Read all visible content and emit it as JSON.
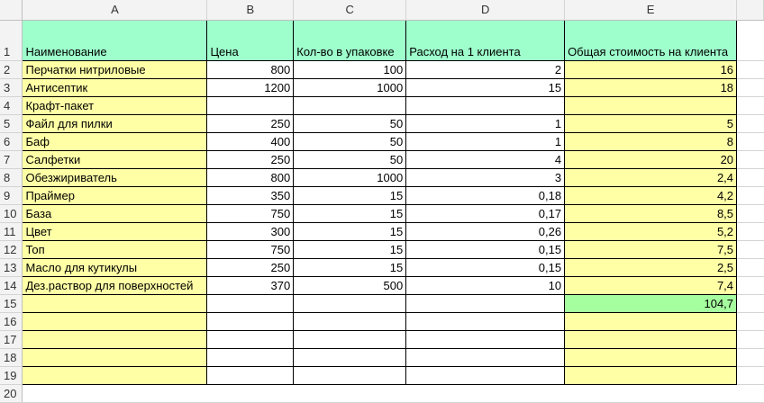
{
  "columns": [
    "A",
    "B",
    "C",
    "D",
    "E"
  ],
  "row_numbers": [
    "1",
    "2",
    "3",
    "4",
    "5",
    "6",
    "7",
    "8",
    "9",
    "10",
    "11",
    "12",
    "13",
    "14",
    "15",
    "16",
    "17",
    "18",
    "19",
    "20"
  ],
  "header": {
    "name": "Наименование",
    "price": "Цена",
    "pack_qty": "Кол-во в упаковке",
    "usage": "Расход на 1 клиента",
    "total": "Общая стоимость на клиента"
  },
  "rows": [
    {
      "name": "Перчатки нитриловые",
      "price": "800",
      "pack_qty": "100",
      "usage": "2",
      "total": "16"
    },
    {
      "name": "Антисептик",
      "price": "1200",
      "pack_qty": "1000",
      "usage": "15",
      "total": "18"
    },
    {
      "name": "Крафт-пакет",
      "price": "",
      "pack_qty": "",
      "usage": "",
      "total": ""
    },
    {
      "name": "Файл для пилки",
      "price": "250",
      "pack_qty": "50",
      "usage": "1",
      "total": "5"
    },
    {
      "name": "Баф",
      "price": "400",
      "pack_qty": "50",
      "usage": "1",
      "total": "8"
    },
    {
      "name": "Салфетки",
      "price": "250",
      "pack_qty": "50",
      "usage": "4",
      "total": "20"
    },
    {
      "name": "Обезжириватель",
      "price": "800",
      "pack_qty": "1000",
      "usage": "3",
      "total": "2,4"
    },
    {
      "name": "Праймер",
      "price": "350",
      "pack_qty": "15",
      "usage": "0,18",
      "total": "4,2"
    },
    {
      "name": "База",
      "price": "750",
      "pack_qty": "15",
      "usage": "0,17",
      "total": "8,5"
    },
    {
      "name": "Цвет",
      "price": "300",
      "pack_qty": "15",
      "usage": "0,26",
      "total": "5,2"
    },
    {
      "name": "Топ",
      "price": "750",
      "pack_qty": "15",
      "usage": "0,15",
      "total": "7,5"
    },
    {
      "name": "Масло для кутикулы",
      "price": "250",
      "pack_qty": "15",
      "usage": "0,15",
      "total": "2,5"
    },
    {
      "name": "Дез.раствор для поверхностей",
      "price": "370",
      "pack_qty": "500",
      "usage": "10",
      "total": "7,4"
    }
  ],
  "grand_total": "104,7",
  "colors": {
    "header_fill": "#9effcc",
    "name_fill": "#ffffa6",
    "total_fill": "#a6ff9e"
  }
}
